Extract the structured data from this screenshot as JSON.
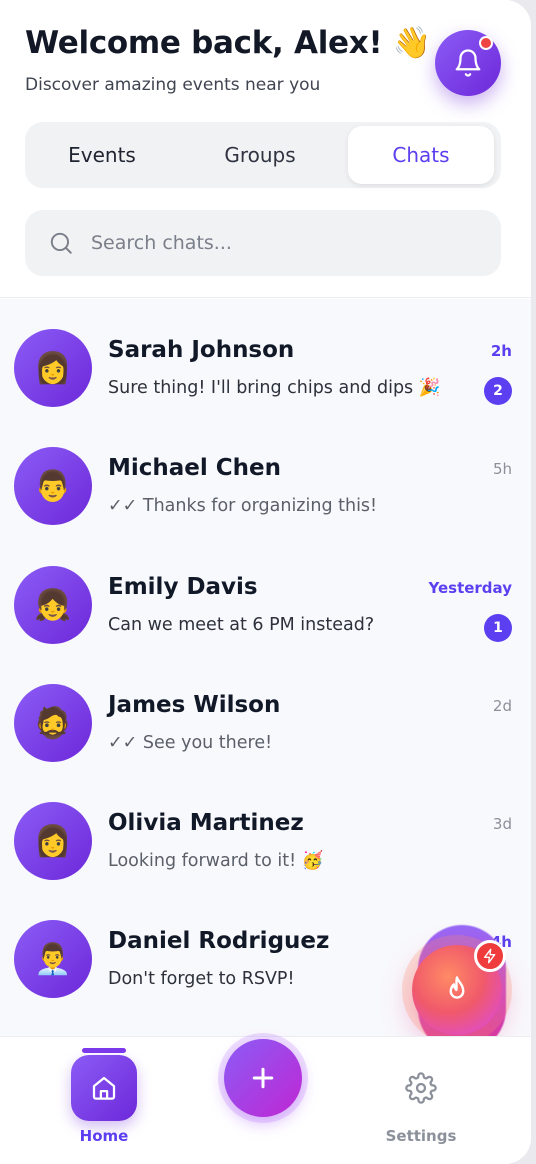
{
  "header": {
    "welcome": "Welcome back, Alex! 👋",
    "subtitle": "Discover amazing events near you",
    "notification_icon": "bell-icon",
    "has_unread_notification": true
  },
  "tabs": [
    {
      "label": "Events",
      "active": false
    },
    {
      "label": "Groups",
      "active": false
    },
    {
      "label": "Chats",
      "active": true
    }
  ],
  "search": {
    "placeholder": "Search chats...",
    "value": "",
    "icon": "search-icon"
  },
  "chats": [
    {
      "name": "Sarah Johnson",
      "avatar": "👩",
      "message": "Sure thing! I'll bring chips and dips 🎉",
      "time": "2h",
      "unread": 2
    },
    {
      "name": "Michael Chen",
      "avatar": "👨",
      "message": "✓✓ Thanks for organizing this!",
      "time": "5h",
      "unread": 0
    },
    {
      "name": "Emily Davis",
      "avatar": "👧",
      "message": "Can we meet at 6 PM instead?",
      "time": "Yesterday",
      "unread": 1
    },
    {
      "name": "James Wilson",
      "avatar": "🧔",
      "message": "✓✓ See you there!",
      "time": "2d",
      "unread": 0
    },
    {
      "name": "Olivia Martinez",
      "avatar": "👩",
      "message": "Looking forward to it! 🥳",
      "time": "3d",
      "unread": 0
    },
    {
      "name": "Daniel Rodriguez",
      "avatar": "👨‍💼",
      "message": "Don't forget to RSVP!",
      "time": "4h",
      "unread": 0
    }
  ],
  "floating_action": {
    "icon": "flame-icon",
    "badge_icon": "lightning-icon"
  },
  "bottom_nav": {
    "home_label": "Home",
    "home_icon": "home-icon",
    "add_icon": "plus-icon",
    "settings_label": "Settings",
    "settings_icon": "gear-icon"
  },
  "colors": {
    "accent": "#5b3ff0",
    "gradient_start": "#8b5cf6",
    "gradient_end": "#6d28d9",
    "notification_dot": "#ef4444"
  }
}
